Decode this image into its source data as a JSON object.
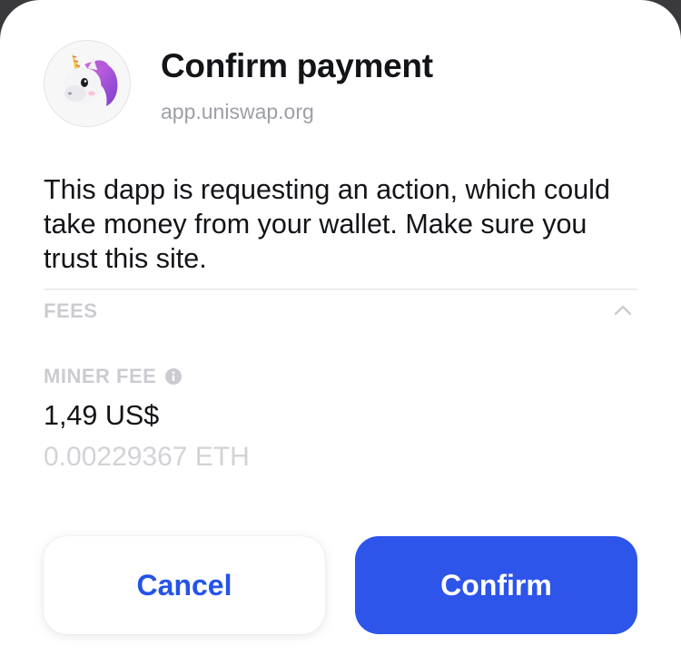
{
  "dialog": {
    "title": "Confirm payment",
    "site": "app.uniswap.org",
    "description": "This dapp is requesting an action, which could take money from your wallet. Make sure you trust this site.",
    "avatar_icon": "unicorn-icon"
  },
  "fees": {
    "section_label": "FEES",
    "expanded": true,
    "miner_fee_label": "MINER FEE",
    "miner_fee_usd": "1,49 US$",
    "miner_fee_eth": "0.00229367 ETH"
  },
  "actions": {
    "cancel_label": "Cancel",
    "confirm_label": "Confirm"
  },
  "colors": {
    "accent": "#2d55ea",
    "text_primary": "#121417",
    "text_muted": "#9d9fa6"
  }
}
